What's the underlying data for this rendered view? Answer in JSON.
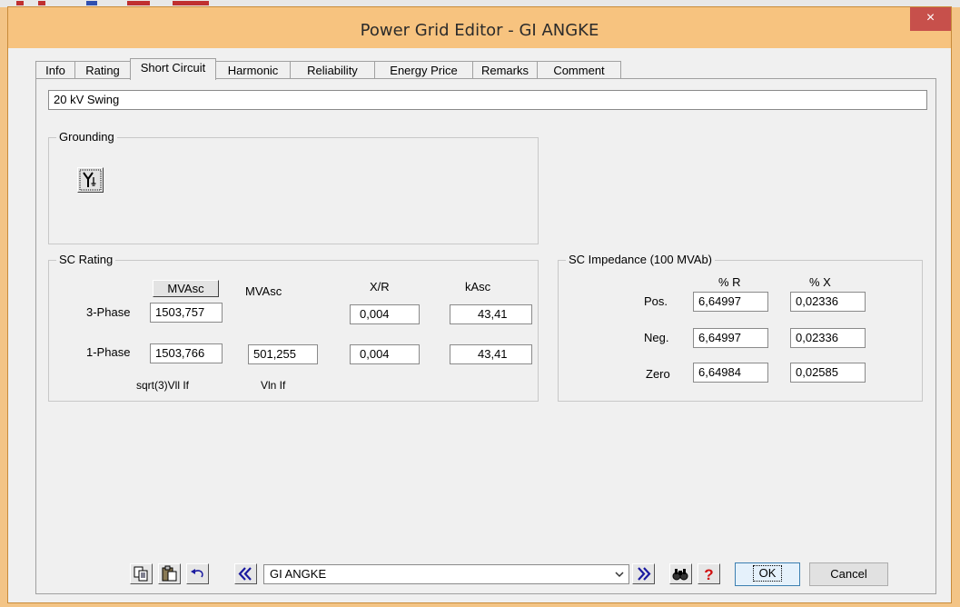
{
  "window": {
    "title": "Power Grid Editor - GI ANGKE",
    "close_label": "×"
  },
  "tabs": [
    {
      "label": "Info"
    },
    {
      "label": "Rating"
    },
    {
      "label": "Short Circuit",
      "active": true
    },
    {
      "label": "Harmonic"
    },
    {
      "label": "Reliability"
    },
    {
      "label": "Energy Price"
    },
    {
      "label": "Remarks"
    },
    {
      "label": "Comment"
    }
  ],
  "info_line": "20 kV  Swing",
  "grounding": {
    "title": "Grounding",
    "icon": "wye-grounded-icon"
  },
  "sc_rating": {
    "title": "SC Rating",
    "headers": {
      "mvasc_button": "MVAsc",
      "mvasc": "MVAsc",
      "xr": "X/R",
      "kasc": "kAsc"
    },
    "three_phase": {
      "label": "3-Phase",
      "mvasc": "1503,757",
      "xr": "0,004",
      "kasc": "43,41"
    },
    "one_phase": {
      "label": "1-Phase",
      "mvasc": "1503,766",
      "mvasc2": "501,255",
      "xr": "0,004",
      "kasc": "43,41"
    },
    "footer": {
      "left": "sqrt(3)Vll If",
      "right": "Vln If"
    }
  },
  "sc_impedance": {
    "title": "SC Impedance (100 MVAb)",
    "col_r": "% R",
    "col_x": "% X",
    "rows": [
      {
        "label": "Pos.",
        "r": "6,64997",
        "x": "0,02336"
      },
      {
        "label": "Neg.",
        "r": "6,64997",
        "x": "0,02336"
      },
      {
        "label": "Zero",
        "r": "6,64984",
        "x": "0,02585"
      }
    ]
  },
  "toolbar": {
    "element_select": "GI ANGKE",
    "ok_label": "OK",
    "cancel_label": "Cancel",
    "icons": [
      "copy-icon",
      "paste-icon",
      "undo-icon",
      "previous-icon",
      "next-icon",
      "find-icon",
      "help-icon"
    ]
  },
  "colors": {
    "title_bar": "#f7c37f",
    "close_button": "#c7504b",
    "dialog_bg": "#f0f0f0",
    "nav_arrow": "#1a1aa0",
    "help_red": "#d01010"
  }
}
